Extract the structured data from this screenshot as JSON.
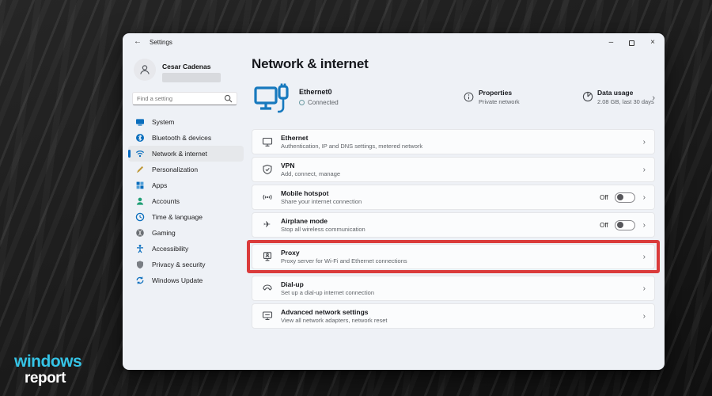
{
  "logo": {
    "line1": "windows",
    "line2": "report"
  },
  "colors": {
    "accent_blue": "#0067c0",
    "icon_blue": "#0a6ebd",
    "highlight_red": "#da3b3b",
    "logo_cyan": "#35c4e6"
  },
  "icons": {
    "chevron": "›",
    "back_arrow": "←",
    "minimize": "–",
    "close": "×",
    "plane": "✈"
  },
  "titlebar": {
    "title": "Settings"
  },
  "sidebar": {
    "user_name": "Cesar Cadenas",
    "search_placeholder": "Find a setting",
    "items": [
      {
        "label": "System"
      },
      {
        "label": "Bluetooth & devices"
      },
      {
        "label": "Network & internet",
        "selected": true
      },
      {
        "label": "Personalization"
      },
      {
        "label": "Apps"
      },
      {
        "label": "Accounts"
      },
      {
        "label": "Time & language"
      },
      {
        "label": "Gaming"
      },
      {
        "label": "Accessibility"
      },
      {
        "label": "Privacy & security"
      },
      {
        "label": "Windows Update"
      }
    ]
  },
  "main": {
    "page_title": "Network & internet",
    "hero": {
      "network_name": "Ethernet0",
      "status": "Connected",
      "properties_title": "Properties",
      "properties_subtitle": "Private network",
      "data_usage_title": "Data usage",
      "data_usage_subtitle": "2.08 GB, last 30 days"
    },
    "rows": [
      {
        "title": "Ethernet",
        "subtitle": "Authentication, IP and DNS settings, metered network"
      },
      {
        "title": "VPN",
        "subtitle": "Add, connect, manage"
      },
      {
        "title": "Mobile hotspot",
        "subtitle": "Share your internet connection",
        "toggle_label": "Off"
      },
      {
        "title": "Airplane mode",
        "subtitle": "Stop all wireless communication",
        "toggle_label": "Off"
      },
      {
        "title": "Proxy",
        "subtitle": "Proxy server for Wi-Fi and Ethernet connections"
      },
      {
        "title": "Dial-up",
        "subtitle": "Set up a dial-up internet connection"
      },
      {
        "title": "Advanced network settings",
        "subtitle": "View all network adapters, network reset"
      }
    ]
  }
}
